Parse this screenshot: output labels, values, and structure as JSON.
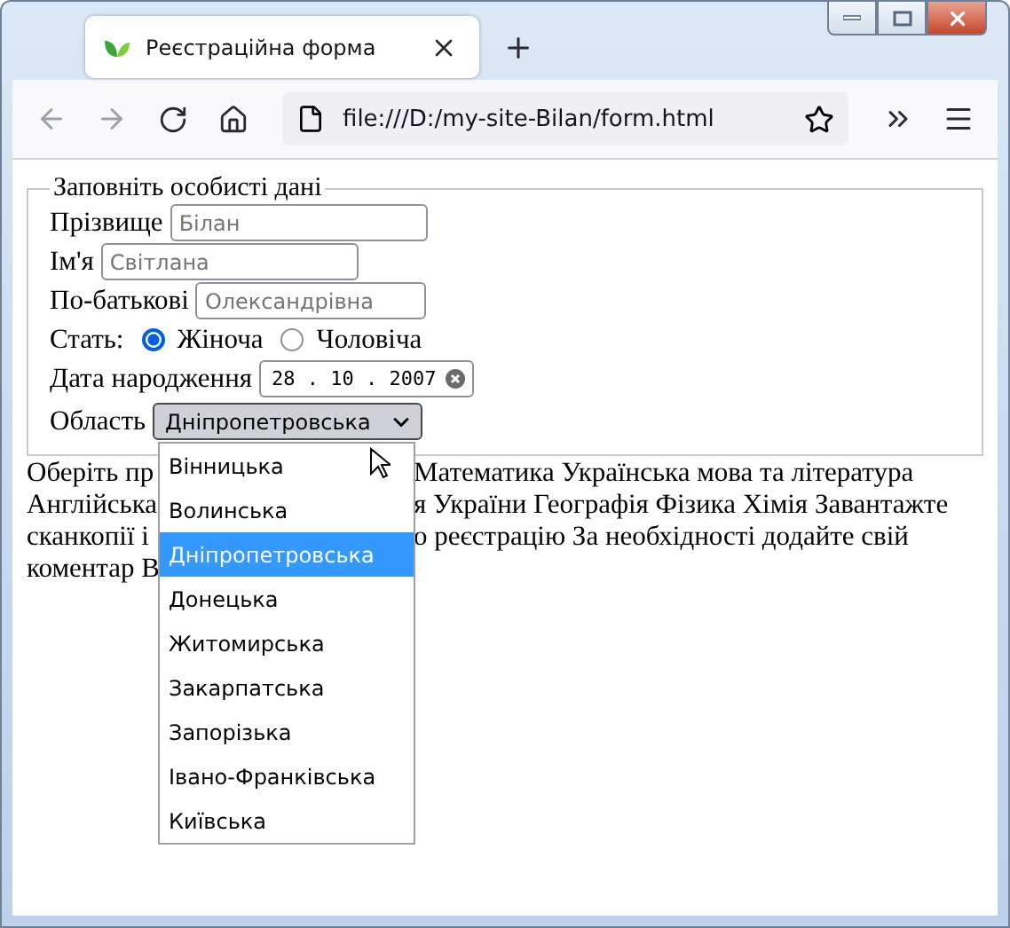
{
  "tab": {
    "title": "Реєстраційна форма"
  },
  "address_bar": {
    "url": "file:///D:/my-site-Bilan/form.html"
  },
  "form": {
    "legend": "Заповніть особисті дані",
    "fields": [
      {
        "kind": "text",
        "label": "Прізвище",
        "placeholder": "Білан"
      },
      {
        "kind": "text",
        "label": "Ім'я",
        "placeholder": "Світлана"
      },
      {
        "kind": "text",
        "label": "По-батькові",
        "placeholder": "Олександрівна"
      },
      {
        "kind": "radio",
        "label": "Стать:",
        "options": [
          {
            "label": "Жіноча",
            "selected": true
          },
          {
            "label": "Чоловіча",
            "selected": false
          }
        ]
      },
      {
        "kind": "date",
        "label": "Дата народження",
        "value": "28 . 10 . 2007"
      },
      {
        "kind": "select",
        "label": "Область",
        "value": "Дніпропетровська",
        "expanded": true,
        "options": [
          {
            "label": "Вінницька",
            "selected": false
          },
          {
            "label": "Волинська",
            "selected": false
          },
          {
            "label": "Дніпропетровська",
            "selected": true
          },
          {
            "label": "Донецька",
            "selected": false
          },
          {
            "label": "Житомирська",
            "selected": false
          },
          {
            "label": "Закарпатська",
            "selected": false
          },
          {
            "label": "Запорізька",
            "selected": false
          },
          {
            "label": "Івано-Франківська",
            "selected": false
          },
          {
            "label": "Київська",
            "selected": false
          }
        ]
      }
    ]
  },
  "paragraph_lines": [
    {
      "left": "Оберіть пр",
      "right": "Математика Українська мова та література"
    },
    {
      "left": "Англійська",
      "right": "я України Географія Фізика Хімія Завантажте"
    },
    {
      "left": "сканкопії і",
      "right": "о реєстрацію За необхідності додайте свій"
    },
    {
      "left": "коментар В"
    }
  ]
}
